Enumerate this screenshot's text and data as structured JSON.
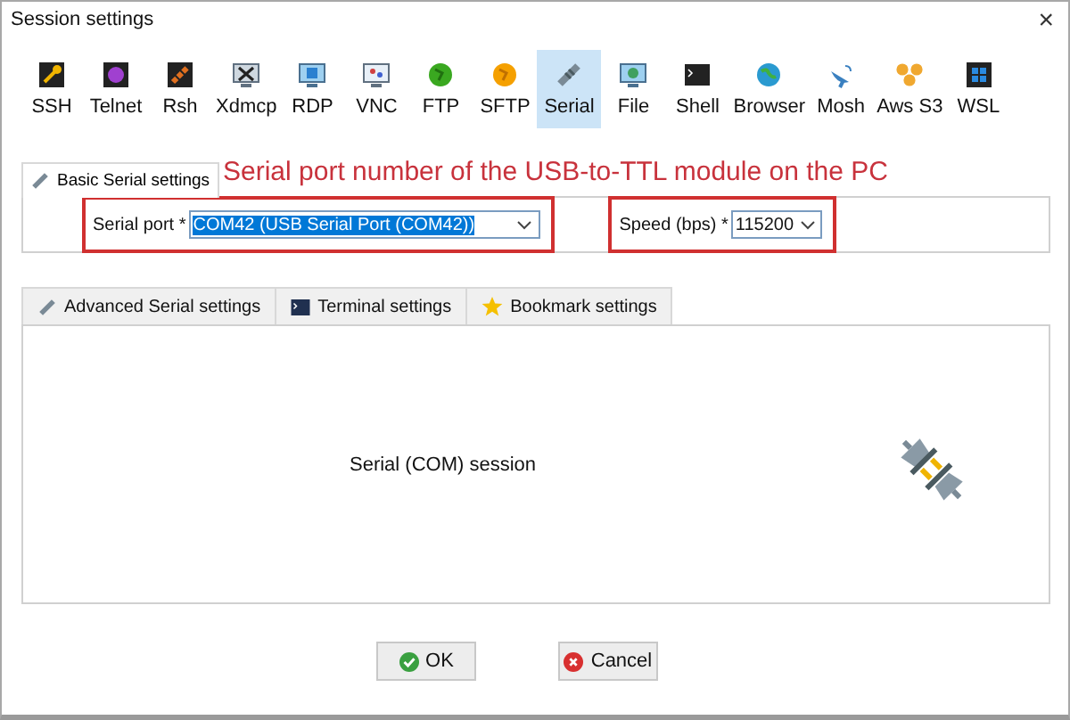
{
  "window": {
    "title": "Session settings",
    "close": "×"
  },
  "session_types": [
    {
      "label": "SSH",
      "selected": false
    },
    {
      "label": "Telnet",
      "selected": false
    },
    {
      "label": "Rsh",
      "selected": false
    },
    {
      "label": "Xdmcp",
      "selected": false
    },
    {
      "label": "RDP",
      "selected": false
    },
    {
      "label": "VNC",
      "selected": false
    },
    {
      "label": "FTP",
      "selected": false
    },
    {
      "label": "SFTP",
      "selected": false
    },
    {
      "label": "Serial",
      "selected": true
    },
    {
      "label": "File",
      "selected": false
    },
    {
      "label": "Shell",
      "selected": false
    },
    {
      "label": "Browser",
      "selected": false
    },
    {
      "label": "Mosh",
      "selected": false
    },
    {
      "label": "Aws S3",
      "selected": false
    },
    {
      "label": "WSL",
      "selected": false
    }
  ],
  "annotation": "Serial port number of the USB-to-TTL module on the PC",
  "basic_tab": {
    "label": "Basic Serial settings"
  },
  "fields": [
    {
      "label": "Serial port *",
      "value": "COM42  (USB Serial Port (COM42))",
      "highlighted": true,
      "value_selected": true
    },
    {
      "label": "Speed (bps) *",
      "value": "115200",
      "highlighted": true,
      "value_selected": false
    }
  ],
  "lower_tabs": [
    {
      "label": "Advanced Serial settings"
    },
    {
      "label": "Terminal settings"
    },
    {
      "label": "Bookmark settings"
    }
  ],
  "session_caption": "Serial (COM) session",
  "buttons": [
    {
      "label": "OK",
      "kind": "ok"
    },
    {
      "label": "Cancel",
      "kind": "cancel"
    }
  ]
}
